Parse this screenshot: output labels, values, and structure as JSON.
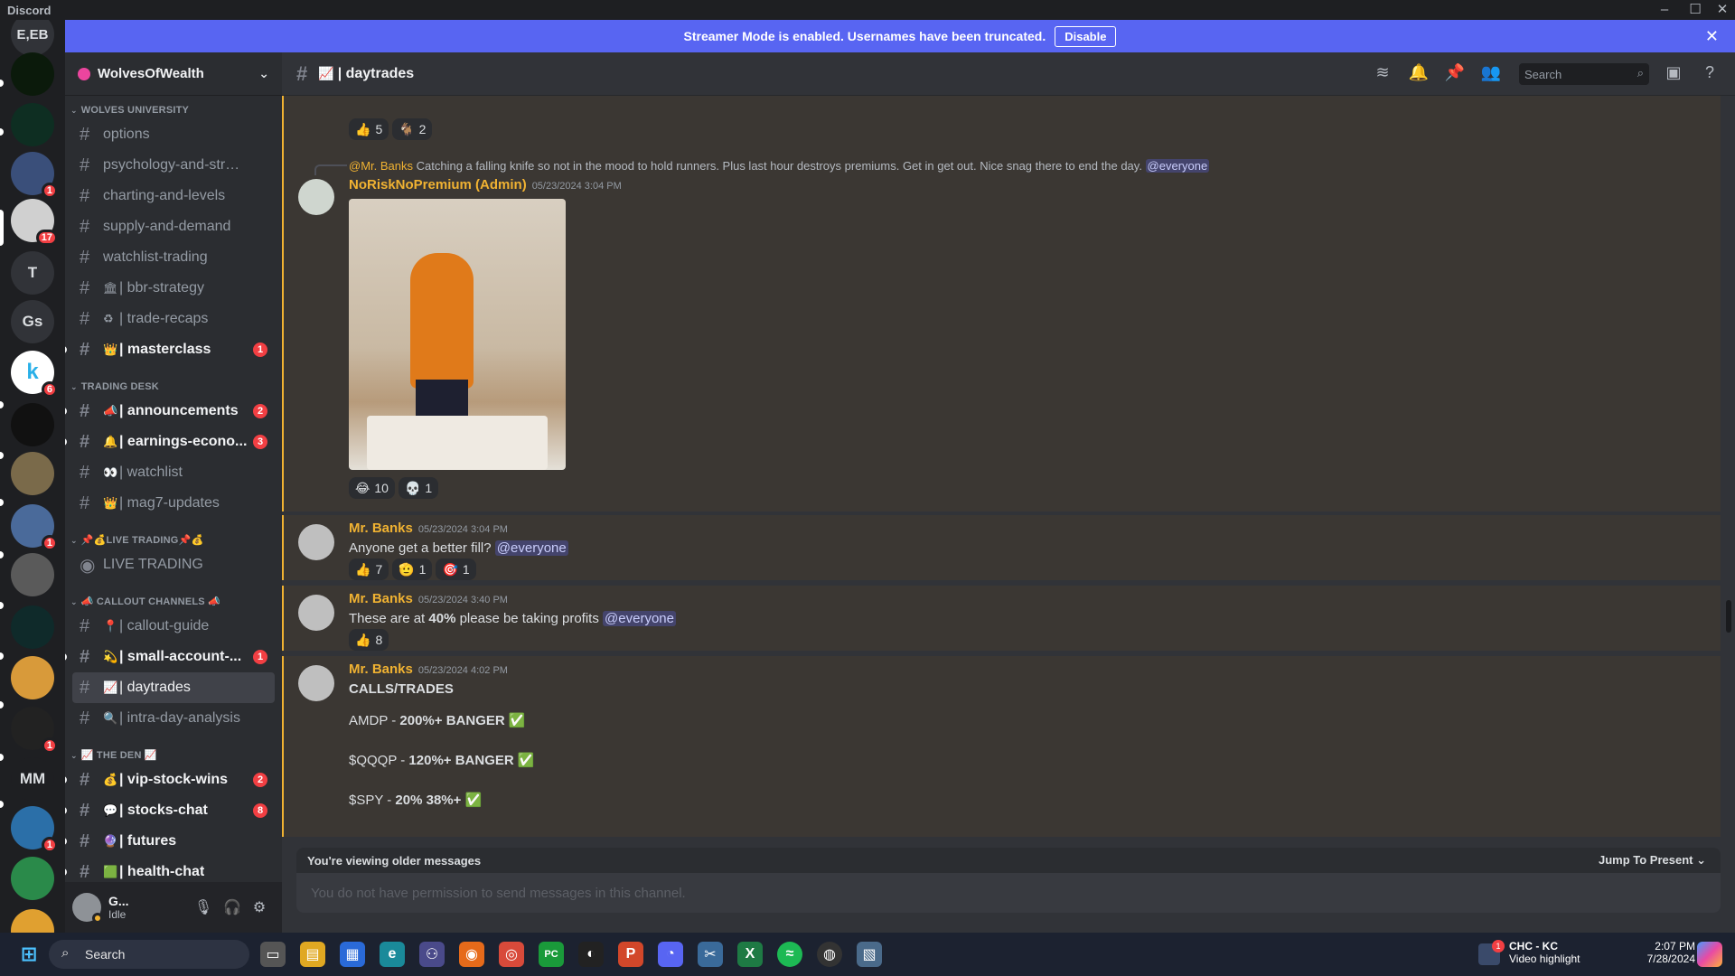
{
  "window": {
    "app_title": "Discord"
  },
  "banner": {
    "text": "Streamer Mode is enabled. Usernames have been truncated.",
    "button": "Disable"
  },
  "rail": {
    "top_label": "E,EB",
    "servers": [
      {
        "label": "",
        "color": "#0b1a0b",
        "badge": "",
        "icon": "dark-green-server-icon"
      },
      {
        "label": "",
        "color": "#0e2e22",
        "badge": "",
        "icon": "lightbulb-leaf-server-icon"
      },
      {
        "label": "",
        "color": "#3a4f7a",
        "badge": "1",
        "icon": "art-server-icon"
      },
      {
        "label": "",
        "color": "#d0d0d0",
        "badge": "17",
        "icon": "wolves-logo-icon"
      },
      {
        "label": "T",
        "color": "#313338",
        "badge": ""
      },
      {
        "label": "Gs",
        "color": "#313338",
        "badge": ""
      },
      {
        "label": "k",
        "color": "#ffffff",
        "badge": "6",
        "icon": "k-server-icon"
      },
      {
        "label": "",
        "color": "#111111",
        "badge": "",
        "icon": "moon-server-icon"
      },
      {
        "label": "",
        "color": "#7a6a4a",
        "badge": "",
        "icon": "dog-server-icon"
      },
      {
        "label": "",
        "color": "#4a6a9a",
        "badge": "1",
        "icon": "cartoon-server-icon"
      },
      {
        "label": "",
        "color": "#5a5a5a",
        "badge": "",
        "icon": "bus-server-icon"
      },
      {
        "label": "",
        "color": "#0f2a2a",
        "badge": "",
        "icon": "bulb-server-icon"
      },
      {
        "label": "",
        "color": "#d89a3a",
        "badge": "",
        "icon": "dog-cartoon-server-icon"
      },
      {
        "label": "",
        "color": "#222222",
        "badge": "1",
        "icon": "drum-server-icon"
      },
      {
        "label": "MM",
        "color": "#1e1f22",
        "badge": "",
        "icon": "mm-server-icon"
      },
      {
        "label": "",
        "color": "#2b6fa8",
        "badge": "1",
        "icon": "sailboat-server-icon"
      },
      {
        "label": "",
        "color": "#2a8a4a",
        "badge": "",
        "icon": "rocket-server-icon"
      },
      {
        "label": "",
        "color": "#e0a030",
        "badge": "",
        "icon": "partial-server-icon"
      }
    ]
  },
  "sidebar": {
    "server_name": "WolvesOfWealth",
    "categories": [
      {
        "name": "WOLVES UNIVERSITY",
        "channels": [
          {
            "emoji": "",
            "label": "options"
          },
          {
            "emoji": "",
            "label": "psychology-and-strategi..."
          },
          {
            "emoji": "",
            "label": "charting-and-levels"
          },
          {
            "emoji": "",
            "label": "supply-and-demand"
          },
          {
            "emoji": "",
            "label": "watchlist-trading"
          },
          {
            "emoji": "🏛",
            "label": "| bbr-strategy"
          },
          {
            "emoji": "♻",
            "label": "| trade-recaps"
          },
          {
            "emoji": "👑",
            "label": "| masterclass",
            "unread": true,
            "badge": "1"
          }
        ]
      },
      {
        "name": "TRADING DESK",
        "channels": [
          {
            "emoji": "📣",
            "label": "| announcements",
            "unread": true,
            "badge": "2"
          },
          {
            "emoji": "🔔",
            "label": "| earnings-econo...",
            "unread": true,
            "badge": "3"
          },
          {
            "emoji": "👀",
            "label": "| watchlist"
          },
          {
            "emoji": "👑",
            "label": "| mag7-updates"
          }
        ]
      },
      {
        "name": "📌💰LIVE TRADING📌💰",
        "channels": [
          {
            "emoji": "",
            "label": "LIVE TRADING",
            "voice": true
          }
        ]
      },
      {
        "name": "📣 CALLOUT CHANNELS 📣",
        "channels": [
          {
            "emoji": "📍",
            "label": "| callout-guide"
          },
          {
            "emoji": "💫",
            "label": "| small-account-...",
            "unread": true,
            "badge": "1"
          },
          {
            "emoji": "📈",
            "label": "| daytrades",
            "active": true
          },
          {
            "emoji": "🔍",
            "label": "| intra-day-analysis"
          }
        ]
      },
      {
        "name": "📈 THE DEN 📈",
        "channels": [
          {
            "emoji": "💰",
            "label": "| vip-stock-wins",
            "unread": true,
            "badge": "2"
          },
          {
            "emoji": "💬",
            "label": "| stocks-chat",
            "unread": true,
            "badge": "8"
          },
          {
            "emoji": "🔮",
            "label": "| futures",
            "unread": true
          },
          {
            "emoji": "🟩",
            "label": "| health-chat",
            "unread": true
          }
        ]
      }
    ],
    "user": {
      "name": "G...",
      "status": "Idle"
    }
  },
  "chat": {
    "channel_emoji": "📈",
    "channel_name": "| daytrades",
    "search_placeholder": "Search",
    "top_reactions": [
      {
        "emoji": "👍",
        "count": "5"
      },
      {
        "emoji": "🐐",
        "count": "2"
      }
    ],
    "messages": [
      {
        "reply_to": "@Mr. Banks",
        "reply_text": "Catching a falling knife so not in the mood to hold runners. Plus last hour destroys premiums. Get in get out. Nice snag there to end the day.",
        "reply_mention": "@everyone",
        "author": "NoRiskNoPremium (Admin)",
        "author_color": "#f0b232",
        "time": "05/23/2024 3:04 PM",
        "reactions": [
          {
            "emoji": "😂",
            "count": "10"
          },
          {
            "emoji": "💀",
            "count": "1"
          }
        ]
      },
      {
        "author": "Mr. Banks",
        "author_color": "#f0b232",
        "time": "05/23/2024 3:04 PM",
        "text": "Anyone get a better fill?",
        "mention": "@everyone",
        "reactions": [
          {
            "emoji": "👍",
            "count": "7"
          },
          {
            "emoji": "🫡",
            "count": "1"
          },
          {
            "emoji": "🎯",
            "count": "1"
          }
        ]
      },
      {
        "author": "Mr. Banks",
        "author_color": "#f0b232",
        "time": "05/23/2024 3:40 PM",
        "text_pre": "These are at ",
        "text_bold": "40%",
        "text_post": " please be taking profits",
        "mention": "@everyone",
        "reactions": [
          {
            "emoji": "👍",
            "count": "8"
          }
        ]
      },
      {
        "author": "Mr. Banks",
        "author_color": "#f0b232",
        "time": "05/23/2024 4:02 PM",
        "heading": "CALLS/TRADES",
        "lines": [
          {
            "pre": "AMDP - ",
            "bold": "200%+ BANGER",
            "check": "✅"
          },
          {
            "pre": "$QQQP - ",
            "bold": "120%+ BANGER",
            "check": "✅"
          },
          {
            "pre": "$SPY - ",
            "bold": "20% 38%+",
            "check": "✅"
          }
        ]
      }
    ],
    "older_notice": "You're viewing older messages",
    "jump_label": "Jump To Present",
    "composer_placeholder": "You do not have permission to send messages in this channel."
  },
  "taskbar": {
    "search": "Search",
    "weather_title": "CHC - KC",
    "weather_sub": "Video highlight",
    "weather_badge": "1",
    "time": "2:07 PM",
    "date": "7/28/2024"
  },
  "colors": {
    "accent": "#5865f2",
    "mention_bg": "#3c4270",
    "unread_badge": "#f23f43",
    "highlight_border": "#f0b232"
  }
}
